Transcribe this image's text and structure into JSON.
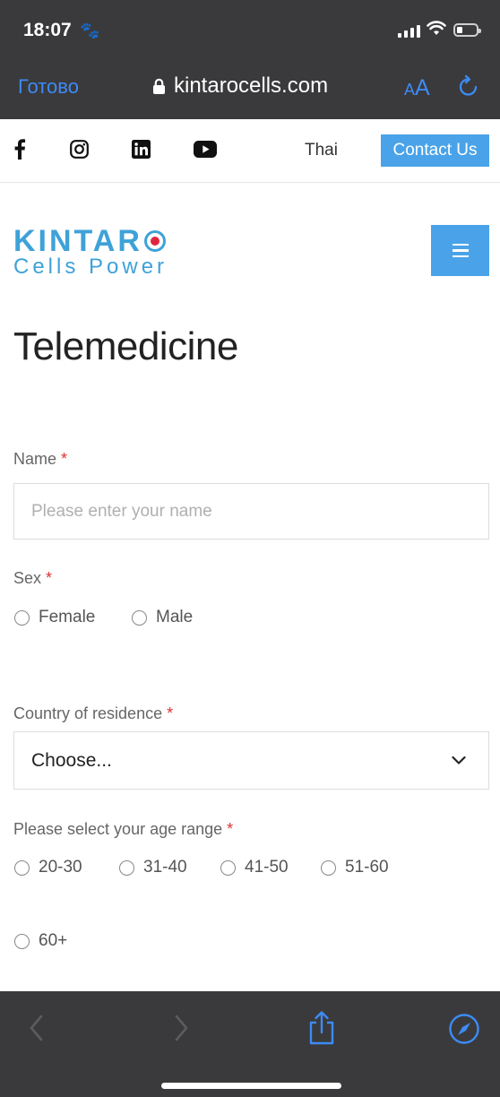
{
  "status_bar": {
    "time": "18:07"
  },
  "browser": {
    "done_label": "Готово",
    "url": "kintarocells.com",
    "text_size_small": "A",
    "text_size_large": "A"
  },
  "site_header": {
    "language": "Thai",
    "contact_label": "Contact Us",
    "logo_line1": "KINTAR",
    "logo_line2": "Cells Power"
  },
  "page": {
    "title": "Telemedicine"
  },
  "form": {
    "name_label": "Name",
    "name_placeholder": "Please enter your name",
    "sex_label": "Sex",
    "sex_options": [
      "Female",
      "Male"
    ],
    "country_label": "Country of residence",
    "country_selected": "Choose...",
    "age_label": "Please select your age range",
    "age_options": [
      "20-30",
      "31-40",
      "41-50",
      "51-60",
      "60+"
    ],
    "required_mark": "*"
  },
  "colors": {
    "accent": "#4aa3e8",
    "logo_blue": "#3ea2d8",
    "logo_red": "#e0263f",
    "safari_blue": "#3d8bf5",
    "chrome_bg": "#3a3a3c",
    "required": "#dd3333"
  }
}
